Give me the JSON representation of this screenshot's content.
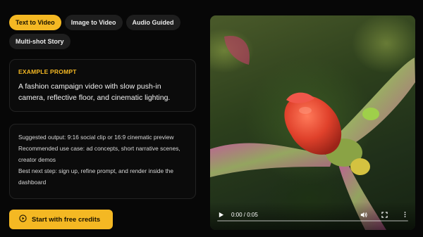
{
  "tabs": [
    {
      "label": "Text to Video",
      "active": true
    },
    {
      "label": "Image to Video",
      "active": false
    },
    {
      "label": "Audio Guided",
      "active": false
    },
    {
      "label": "Multi-shot Story",
      "active": false
    }
  ],
  "prompt": {
    "heading": "EXAMPLE PROMPT",
    "text": "A fashion campaign video with slow push-in camera, reflective floor, and cinematic lighting."
  },
  "info": {
    "lines": [
      "Suggested output: 9:16 social clip or 16:9 cinematic preview",
      "Recommended use case: ad concepts, short narrative scenes, creator demos",
      "Best next step: sign up, refine prompt, and render inside the dashboard"
    ]
  },
  "cta": {
    "label": "Start with free credits",
    "icon": "play-circle-icon"
  },
  "video": {
    "time": "0:00 / 0:05",
    "progress": 0,
    "icons": [
      "play-icon",
      "volume-icon",
      "fullscreen-icon",
      "more-options-icon"
    ]
  },
  "colors": {
    "accent": "#f4b823",
    "background": "#070707",
    "card_border": "#232323"
  }
}
